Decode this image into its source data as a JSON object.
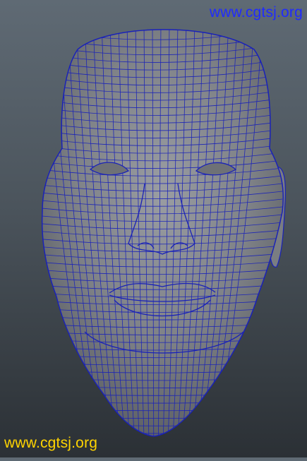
{
  "viewport": {
    "background_top": "#5f6a74",
    "background_bottom": "#2b3035",
    "object": "head-mesh",
    "wire_color": "#1a22b8",
    "shade_color": "#8a8d92"
  },
  "watermarks": {
    "top": "www.cgtsj.org",
    "bottom": "www.cgtsj.org",
    "top_color": "#1f2bff",
    "bottom_color": "#ffd400"
  }
}
